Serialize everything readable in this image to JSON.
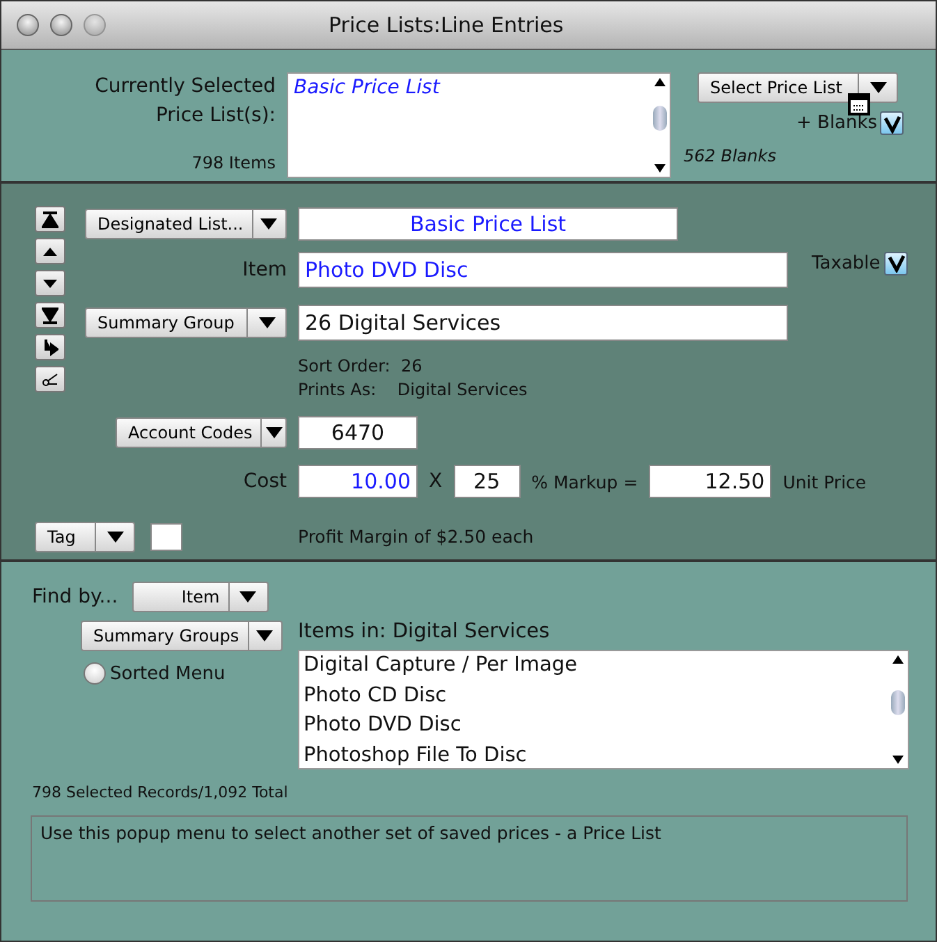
{
  "window": {
    "title": "Price Lists:Line Entries"
  },
  "selection": {
    "label": "Currently Selected Price List(s):",
    "items": [
      "Basic Price List"
    ],
    "count": "798 Items",
    "blanks_count": "562 Blanks",
    "button": "Select Price List",
    "blanks_toggle": {
      "label": "+ Blanks",
      "checked": true
    }
  },
  "record": {
    "designated_popup": "Designated List...",
    "designated_value": "Basic Price List",
    "item_label": "Item",
    "item_value": "Photo DVD Disc",
    "taxable": {
      "label": "Taxable",
      "checked": true
    },
    "summary_popup": "Summary Group",
    "summary_value": "26 Digital Services",
    "sort_order": {
      "label": "Sort Order:",
      "value": "26"
    },
    "prints_as": {
      "label": "Prints As:",
      "value": "Digital Services"
    },
    "account_popup": "Account Codes",
    "account_value": "6470",
    "cost_label": "Cost",
    "cost_value": "10.00",
    "times": "X",
    "markup_value": "25",
    "markup_label": "% Markup =",
    "unit_price_value": "12.50",
    "unit_price_label": "Unit Price",
    "tag_popup": "Tag",
    "profit_text": "Profit Margin of $2.50 each"
  },
  "find": {
    "label": "Find by...",
    "popup": "Item",
    "groups_popup": "Summary Groups",
    "sorted_menu": {
      "label": "Sorted Menu",
      "selected": false
    },
    "items_title": "Items in: Digital Services",
    "items": [
      "Digital Capture / Per Image",
      "Photo CD Disc",
      "Photo DVD Disc",
      "Photoshop File To Disc"
    ]
  },
  "status": "798 Selected Records/1,092 Total",
  "help_text": "Use this popup menu to select another set of saved prices - a Price List"
}
